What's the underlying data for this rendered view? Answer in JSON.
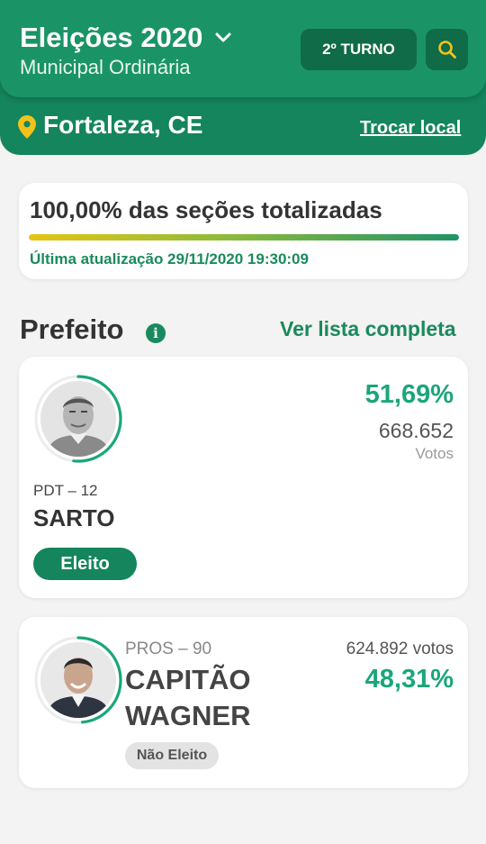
{
  "header": {
    "title": "Eleições 2020",
    "subtitle": "Municipal Ordinária",
    "turno_label": "2º TURNO",
    "location": "Fortaleza, CE",
    "change_location": "Trocar local"
  },
  "status": {
    "title": "100,00% das seções totalizadas",
    "progress": 1.0,
    "last_update": "Última atualização 29/11/2020 19:30:09"
  },
  "section": {
    "title": "Prefeito",
    "see_all": "Ver lista completa"
  },
  "candidates": [
    {
      "party": "PDT – 12",
      "name": "SARTO",
      "percent": "51,69%",
      "share": 0.5169,
      "votes": "668.652",
      "votes_label": "Votos",
      "status": "Eleito"
    },
    {
      "party": "PROS – 90",
      "name": "CAPITÃO WAGNER",
      "percent": "48,31%",
      "share": 0.4831,
      "votes": "624.892 votos",
      "status": "Não Eleito"
    }
  ],
  "colors": {
    "brand": "#1a9466",
    "brand_dark": "#0f6b48",
    "accent": "#f2c21b",
    "percent": "#1aa67a"
  },
  "icons": [
    "chevron-down-icon",
    "search-icon",
    "location-pin-icon",
    "info-icon"
  ]
}
